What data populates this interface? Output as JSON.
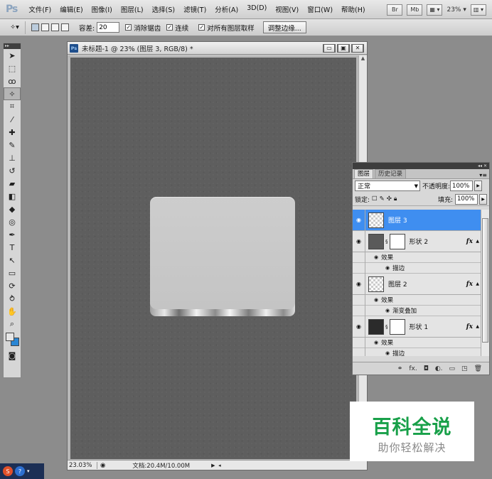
{
  "app": {
    "logo": "Ps",
    "menu": [
      "文件(F)",
      "编辑(E)",
      "图像(I)",
      "图层(L)",
      "选择(S)",
      "滤镜(T)",
      "分析(A)",
      "3D(D)",
      "视图(V)",
      "窗口(W)",
      "帮助(H)"
    ],
    "bridge_label": "Br",
    "minibridge_label": "Mb",
    "zoom_level": "23%"
  },
  "options": {
    "tolerance_label": "容差:",
    "tolerance_value": "20",
    "antialias_label": "消除锯齿",
    "contiguous_label": "连续",
    "sample_all_label": "对所有图层取样",
    "refine_edge_label": "调整边缘..."
  },
  "document": {
    "title": "未标题-1 @ 23% (图层 3, RGB/8) *",
    "ps_badge": "Ps",
    "zoom": "23.03%",
    "doc_info": "文档:20.4M/10.00M"
  },
  "layers_panel": {
    "tab_layers": "图层",
    "tab_history": "历史记录",
    "blend_mode": "正常",
    "opacity_label": "不透明度:",
    "opacity_value": "100%",
    "lock_label": "锁定:",
    "fill_label": "填充:",
    "fill_value": "100%",
    "layers": [
      {
        "name": "图层 3",
        "selected": true
      },
      {
        "name": "形状 2",
        "fx": "fx",
        "effects_label": "效果",
        "effects": [
          "描边"
        ]
      },
      {
        "name": "图层 2",
        "fx": "fx",
        "effects_label": "效果",
        "effects": [
          "渐变叠加"
        ]
      },
      {
        "name": "形状 1",
        "fx": "fx",
        "effects_label": "效果",
        "effects": [
          "描边"
        ]
      }
    ]
  },
  "watermark": {
    "title": "百科全说",
    "subtitle": "助你轻松解决"
  },
  "colors": {
    "selection": "#3f8ef0",
    "background_swatch": "#2a86d4",
    "watermark_green": "#18a049"
  }
}
